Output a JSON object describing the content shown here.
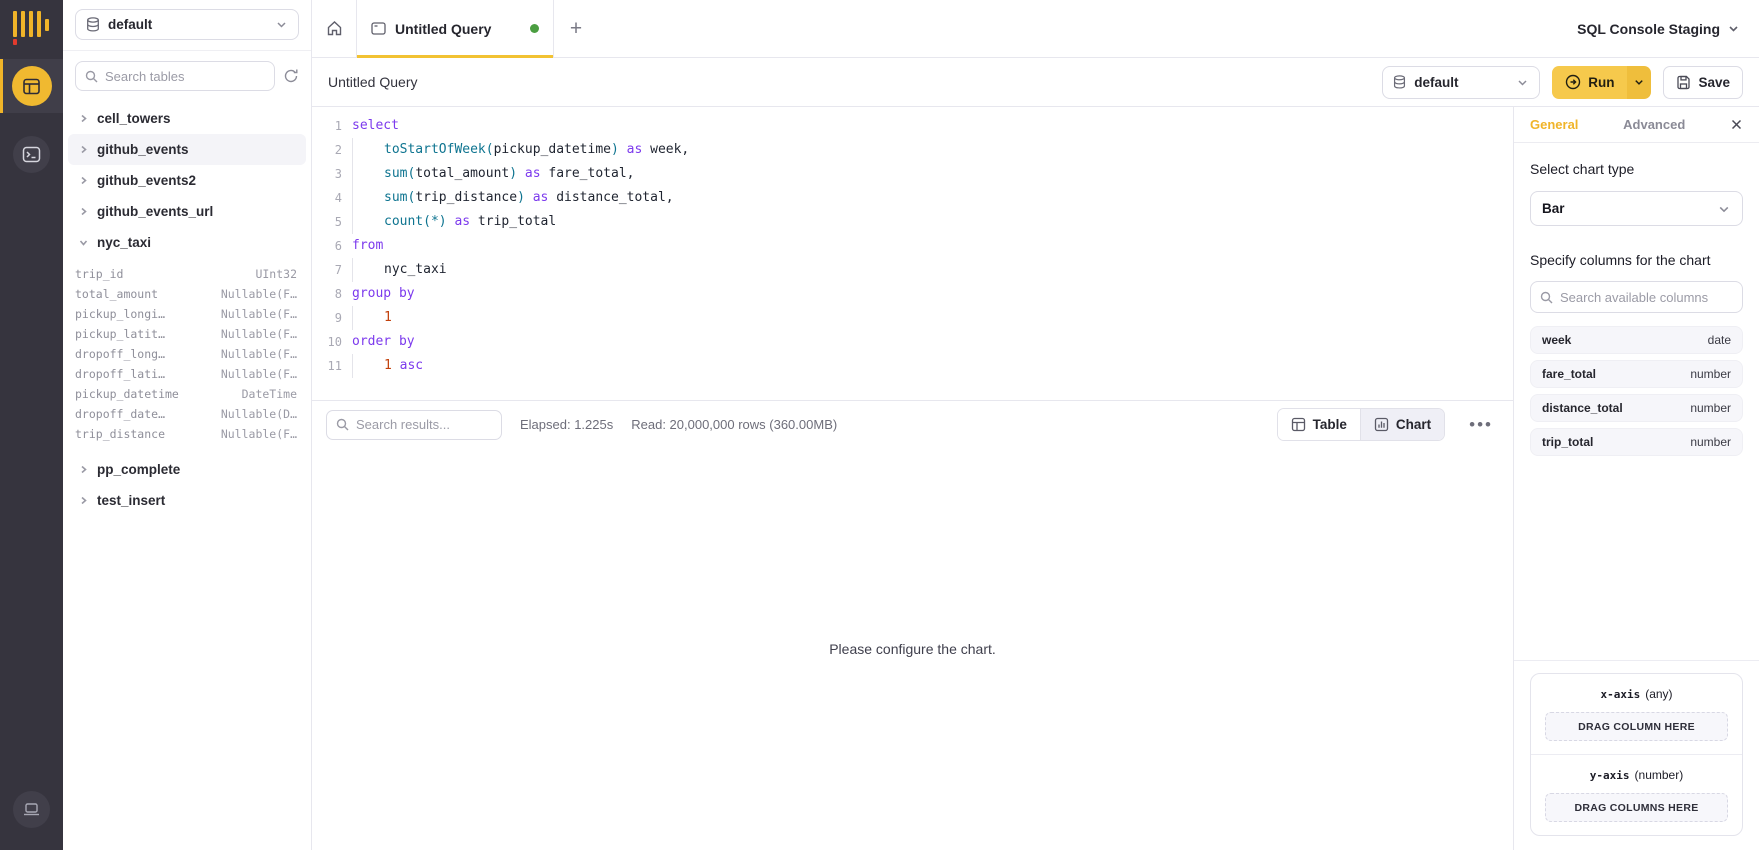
{
  "app": {
    "workspace_label": "SQL Console Staging",
    "accent_color": "#F0B429"
  },
  "sidebar": {
    "database_selector": {
      "value": "default"
    },
    "search_placeholder": "Search tables",
    "tables": [
      {
        "name": "cell_towers",
        "expanded": false
      },
      {
        "name": "github_events",
        "expanded": false,
        "highlighted": true
      },
      {
        "name": "github_events2",
        "expanded": false
      },
      {
        "name": "github_events_url",
        "expanded": false
      },
      {
        "name": "nyc_taxi",
        "expanded": true,
        "columns": [
          {
            "name": "trip_id",
            "type": "UInt32"
          },
          {
            "name": "total_amount",
            "type": "Nullable(F…"
          },
          {
            "name": "pickup_longi…",
            "type": "Nullable(F…"
          },
          {
            "name": "pickup_latit…",
            "type": "Nullable(F…"
          },
          {
            "name": "dropoff_long…",
            "type": "Nullable(F…"
          },
          {
            "name": "dropoff_lati…",
            "type": "Nullable(F…"
          },
          {
            "name": "pickup_datetime",
            "type": "DateTime"
          },
          {
            "name": "dropoff_date…",
            "type": "Nullable(D…"
          },
          {
            "name": "trip_distance",
            "type": "Nullable(F…"
          }
        ]
      },
      {
        "name": "pp_complete",
        "expanded": false
      },
      {
        "name": "test_insert",
        "expanded": false
      }
    ]
  },
  "tabs": {
    "active_tab": {
      "label": "Untitled Query",
      "dirty_dot_color": "#4B9E41"
    },
    "new_tab_label": "+"
  },
  "toolbar": {
    "title": "Untitled Query",
    "database": {
      "value": "default"
    },
    "run_label": "Run",
    "save_label": "Save"
  },
  "editor": {
    "lines": [
      {
        "n": "1",
        "indent": false,
        "tokens": [
          {
            "c": "kw",
            "t": "select"
          }
        ]
      },
      {
        "n": "2",
        "indent": true,
        "tokens": [
          {
            "c": "fn",
            "t": "toStartOfWeek("
          },
          {
            "c": "tx",
            "t": "pickup_datetime"
          },
          {
            "c": "fn",
            "t": ")"
          },
          {
            "c": "kw",
            "t": " as"
          },
          {
            "c": "tx",
            "t": " week,"
          }
        ]
      },
      {
        "n": "3",
        "indent": true,
        "tokens": [
          {
            "c": "fn",
            "t": "sum("
          },
          {
            "c": "tx",
            "t": "total_amount"
          },
          {
            "c": "fn",
            "t": ")"
          },
          {
            "c": "kw",
            "t": " as"
          },
          {
            "c": "tx",
            "t": " fare_total,"
          }
        ]
      },
      {
        "n": "4",
        "indent": true,
        "tokens": [
          {
            "c": "fn",
            "t": "sum("
          },
          {
            "c": "tx",
            "t": "trip_distance"
          },
          {
            "c": "fn",
            "t": ")"
          },
          {
            "c": "kw",
            "t": " as"
          },
          {
            "c": "tx",
            "t": " distance_total,"
          }
        ]
      },
      {
        "n": "5",
        "indent": true,
        "tokens": [
          {
            "c": "fn",
            "t": "count(*)"
          },
          {
            "c": "kw",
            "t": " as"
          },
          {
            "c": "tx",
            "t": " trip_total"
          }
        ]
      },
      {
        "n": "6",
        "indent": false,
        "tokens": [
          {
            "c": "kw",
            "t": "from"
          }
        ]
      },
      {
        "n": "7",
        "indent": true,
        "tokens": [
          {
            "c": "tx",
            "t": "nyc_taxi"
          }
        ]
      },
      {
        "n": "8",
        "indent": false,
        "tokens": [
          {
            "c": "kw",
            "t": "group by"
          }
        ]
      },
      {
        "n": "9",
        "indent": true,
        "tokens": [
          {
            "c": "num",
            "t": "1"
          }
        ]
      },
      {
        "n": "10",
        "indent": false,
        "tokens": [
          {
            "c": "kw",
            "t": "order by"
          }
        ]
      },
      {
        "n": "11",
        "indent": true,
        "tokens": [
          {
            "c": "num",
            "t": "1"
          },
          {
            "c": "kw",
            "t": " asc"
          }
        ]
      }
    ]
  },
  "results": {
    "search_placeholder": "Search results...",
    "elapsed": "Elapsed: 1.225s",
    "read": "Read: 20,000,000 rows (360.00MB)",
    "view_toggle": {
      "table_label": "Table",
      "chart_label": "Chart",
      "active": "Chart"
    },
    "message": "Please configure the chart."
  },
  "chart_panel": {
    "tabs": {
      "general": "General",
      "advanced": "Advanced"
    },
    "chart_type": {
      "label": "Select chart type",
      "value": "Bar"
    },
    "columns_section": {
      "label": "Specify columns for the chart",
      "search_placeholder": "Search available columns",
      "columns": [
        {
          "name": "week",
          "type": "date"
        },
        {
          "name": "fare_total",
          "type": "number"
        },
        {
          "name": "distance_total",
          "type": "number"
        },
        {
          "name": "trip_total",
          "type": "number"
        }
      ]
    },
    "axes": {
      "x": {
        "label": "x-axis",
        "type": "(any)",
        "drop_label": "DRAG COLUMN HERE"
      },
      "y": {
        "label": "y-axis",
        "type": "(number)",
        "drop_label": "DRAG COLUMNS HERE"
      }
    }
  }
}
